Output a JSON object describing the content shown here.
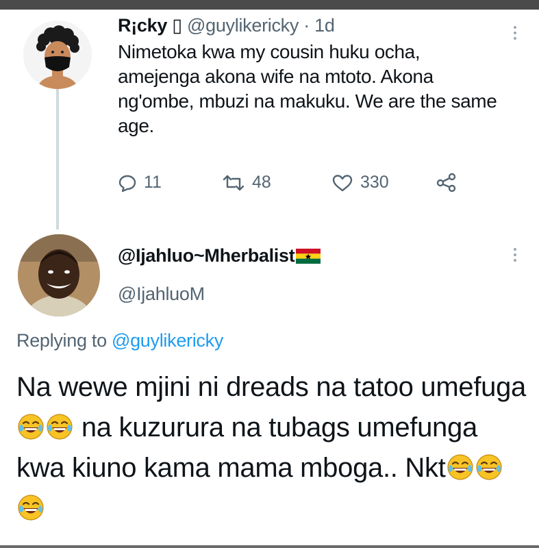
{
  "original_tweet": {
    "name": "R¡cky",
    "name_glyph": "▯",
    "handle": "@guylikericky",
    "separator": "·",
    "time": "1d",
    "text": "Nimetoka kwa my cousin huku ocha, amejenga akona wife na mtoto. Akona ng'ombe, mbuzi na makuku. We are the same age.",
    "actions": {
      "replies": "11",
      "retweets": "48",
      "likes": "330"
    }
  },
  "reply_tweet": {
    "name": "@Ijahluo~Mherbalist",
    "handle": "@IjahluoM",
    "replying_prefix": "Replying to",
    "replying_to": "@guylikericky",
    "text_1": "Na wewe mjini ni dreads na tatoo umefuga",
    "text_2": "na kuzurura na tubags umefunga kwa kiuno kama mama mboga.. Nkt"
  },
  "icons": {
    "reply": "speech-bubble-icon",
    "retweet": "retweet-arrows-icon",
    "like": "heart-icon",
    "share": "share-nodes-icon",
    "more": "vertical-ellipsis-icon",
    "flag": "ghana-flag-icon",
    "emoji": "laughing-tears-emoji"
  },
  "colors": {
    "text": "#0f1419",
    "secondary": "#536471",
    "link": "#1d9bf0",
    "thread_line": "#cfd9de"
  }
}
